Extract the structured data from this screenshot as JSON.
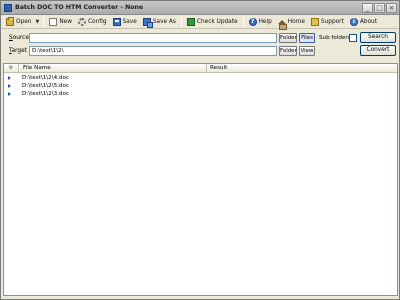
{
  "window": {
    "title": "Batch DOC TO HTM Converter - None",
    "min_glyph": "_",
    "max_glyph": "□",
    "close_glyph": "×"
  },
  "toolbar": {
    "open_label": "Open",
    "new_label": "New",
    "config_label": "Config",
    "save_label": "Save",
    "saveas_label": "Save As",
    "check_update_label": "Check Update",
    "help_label": "Help",
    "home_label": "Home",
    "support_label": "Support",
    "about_label": "About",
    "help_glyph": "?",
    "about_glyph": "i"
  },
  "source": {
    "label_prefix": "",
    "label_underlined": "S",
    "label_rest": "ource",
    "value": "",
    "folder_label": "Folder",
    "files_label": "Files",
    "subfolders_label": "Sub folders",
    "search_label": "Search"
  },
  "target": {
    "label_underlined": "T",
    "label_rest": "arget",
    "value": "D:\\test\\1\\2\\",
    "folder_label": "Folder",
    "view_label": "View",
    "convert_label": "Convert"
  },
  "list": {
    "columns": {
      "icon": "⚙",
      "file": "File Name",
      "result": "Result"
    },
    "rows": [
      {
        "file": "D:\\test\\1\\2\\4.doc",
        "result": ""
      },
      {
        "file": "D:\\test\\1\\2\\5.doc",
        "result": ""
      },
      {
        "file": "D:\\test\\1\\2\\3.doc",
        "result": ""
      }
    ]
  }
}
